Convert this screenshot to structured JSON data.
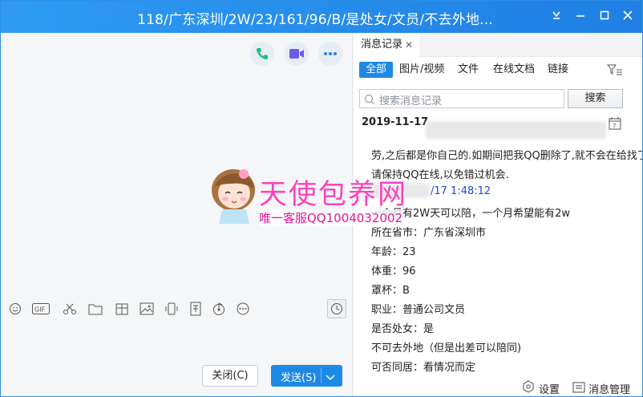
{
  "window": {
    "title": "118/广东深圳/2W/23/161/96/B/是处女/文员/不去外地...",
    "controls": {
      "pin": "⇩",
      "minimize": "—",
      "maximize": "☐",
      "close": "✕"
    }
  },
  "chat_actions": [
    "phone-call",
    "video-call",
    "more"
  ],
  "input_toolbar": [
    "emoji",
    "gif",
    "screenshot",
    "folder",
    "red-packet",
    "image",
    "shake",
    "remote-assist",
    "music",
    "more-tools",
    "history"
  ],
  "buttons": {
    "close": "关闭(C)",
    "send": "发送(S)"
  },
  "history": {
    "tab_label": "消息记录",
    "tab_close": "✕",
    "filters": [
      "全部",
      "图片/视频",
      "文件",
      "在线文档",
      "链接"
    ],
    "search_placeholder": "搜索消息记录",
    "search_button": "搜索",
    "date": "2019-11-17",
    "messages": [
      "劳,之后都是你自己的.如期间把我QQ删除了,就不会在给找了,",
      "请保持QQ在线,以免错过机会.",
      "/17 1:48:12",
      "一个月有2W天可以陪，一个月希望能有2w",
      "所在省市：广东省深圳市",
      "年龄：23",
      "体重：96",
      "罩杯：B",
      "职业：普通公司文员",
      "是否处女：是",
      "不可去外地（但是出差可以陪同)",
      "可否同居：看情况而定"
    ],
    "footer": {
      "settings": "设置",
      "manage": "消息管理"
    }
  },
  "watermark": {
    "title": "天使包养网",
    "subtitle": "唯一客服QQ1004032002"
  },
  "colors": {
    "titlebar": "#1f7fe3",
    "accent": "#1e88e5",
    "watermark_pink": "#ff4fc0"
  }
}
